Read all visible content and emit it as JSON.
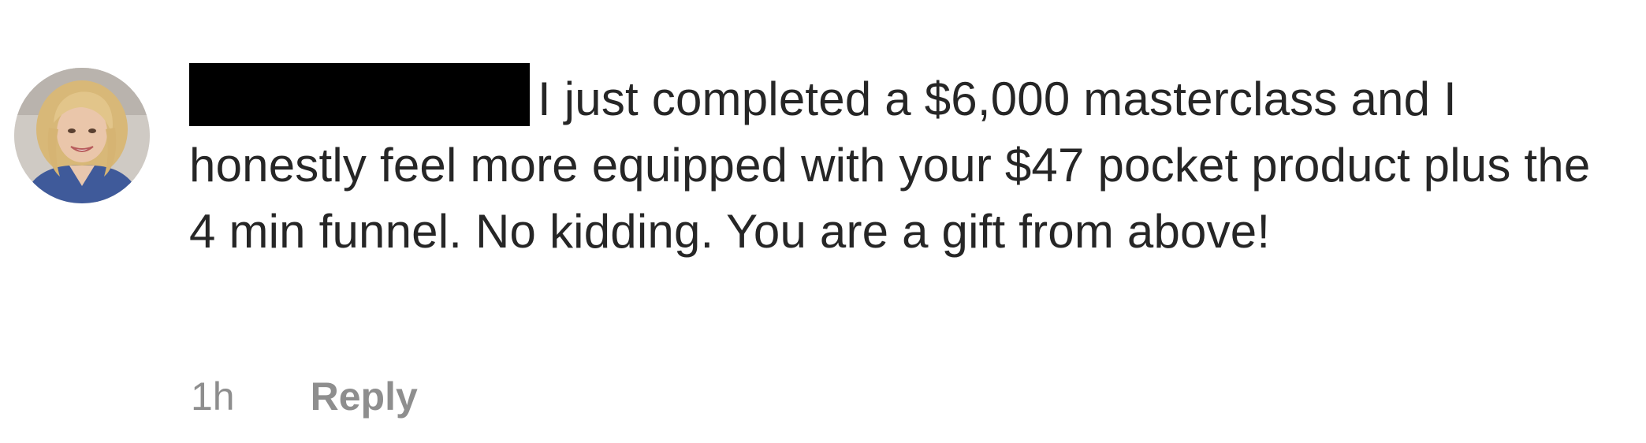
{
  "comment": {
    "text": "I just completed a $6,000 masterclass and I honestly feel more equipped with your $47 pocket product plus the 4 min funnel. No kidding. You are a gift from above!",
    "timestamp": "1h",
    "reply_label": "Reply",
    "username_redacted": true,
    "avatar_icon": "user-avatar-icon"
  },
  "colors": {
    "text": "#262626",
    "meta": "#8e8e8e",
    "redaction": "#000000",
    "background": "#ffffff"
  }
}
